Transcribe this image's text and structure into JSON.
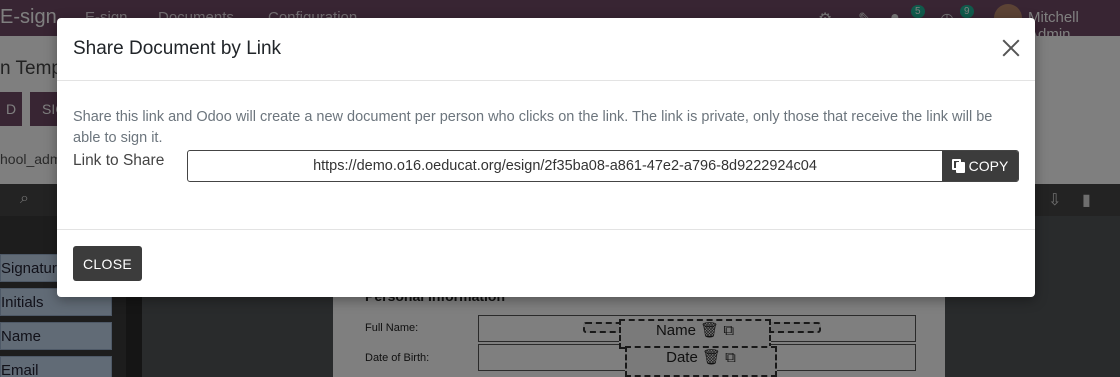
{
  "app": {
    "brand": "E-sign",
    "menu": [
      "E-sign",
      "Documents",
      "Configuration"
    ],
    "notifications": {
      "messages_count": "5",
      "activities_count": "9"
    },
    "user_name": "Mitchell Admin"
  },
  "control_panel": {
    "title_fragment": "n Temp",
    "button_a": "D",
    "button_b": "SIG",
    "user_fragment": "hool_adm"
  },
  "side_fields": [
    "Signature",
    "Initials",
    "Name",
    "Email"
  ],
  "document": {
    "heading": "Personal Information",
    "rows": [
      {
        "label": "Full Name:",
        "field": "Name"
      },
      {
        "label": "Date of Birth:",
        "field": "Date"
      }
    ]
  },
  "dialog": {
    "title": "Share Document by Link",
    "description": "Share this link and Odoo will create a new document per person who clicks on the link. The link is private, only those that receive the link will be able to sign it.",
    "link_label": "Link to Share",
    "link_value": "https://demo.o16.oeducat.org/esign/2f35ba08-a861-47e2-a796-8d9222924c04",
    "copy_label": "COPY",
    "close_label": "CLOSE"
  }
}
